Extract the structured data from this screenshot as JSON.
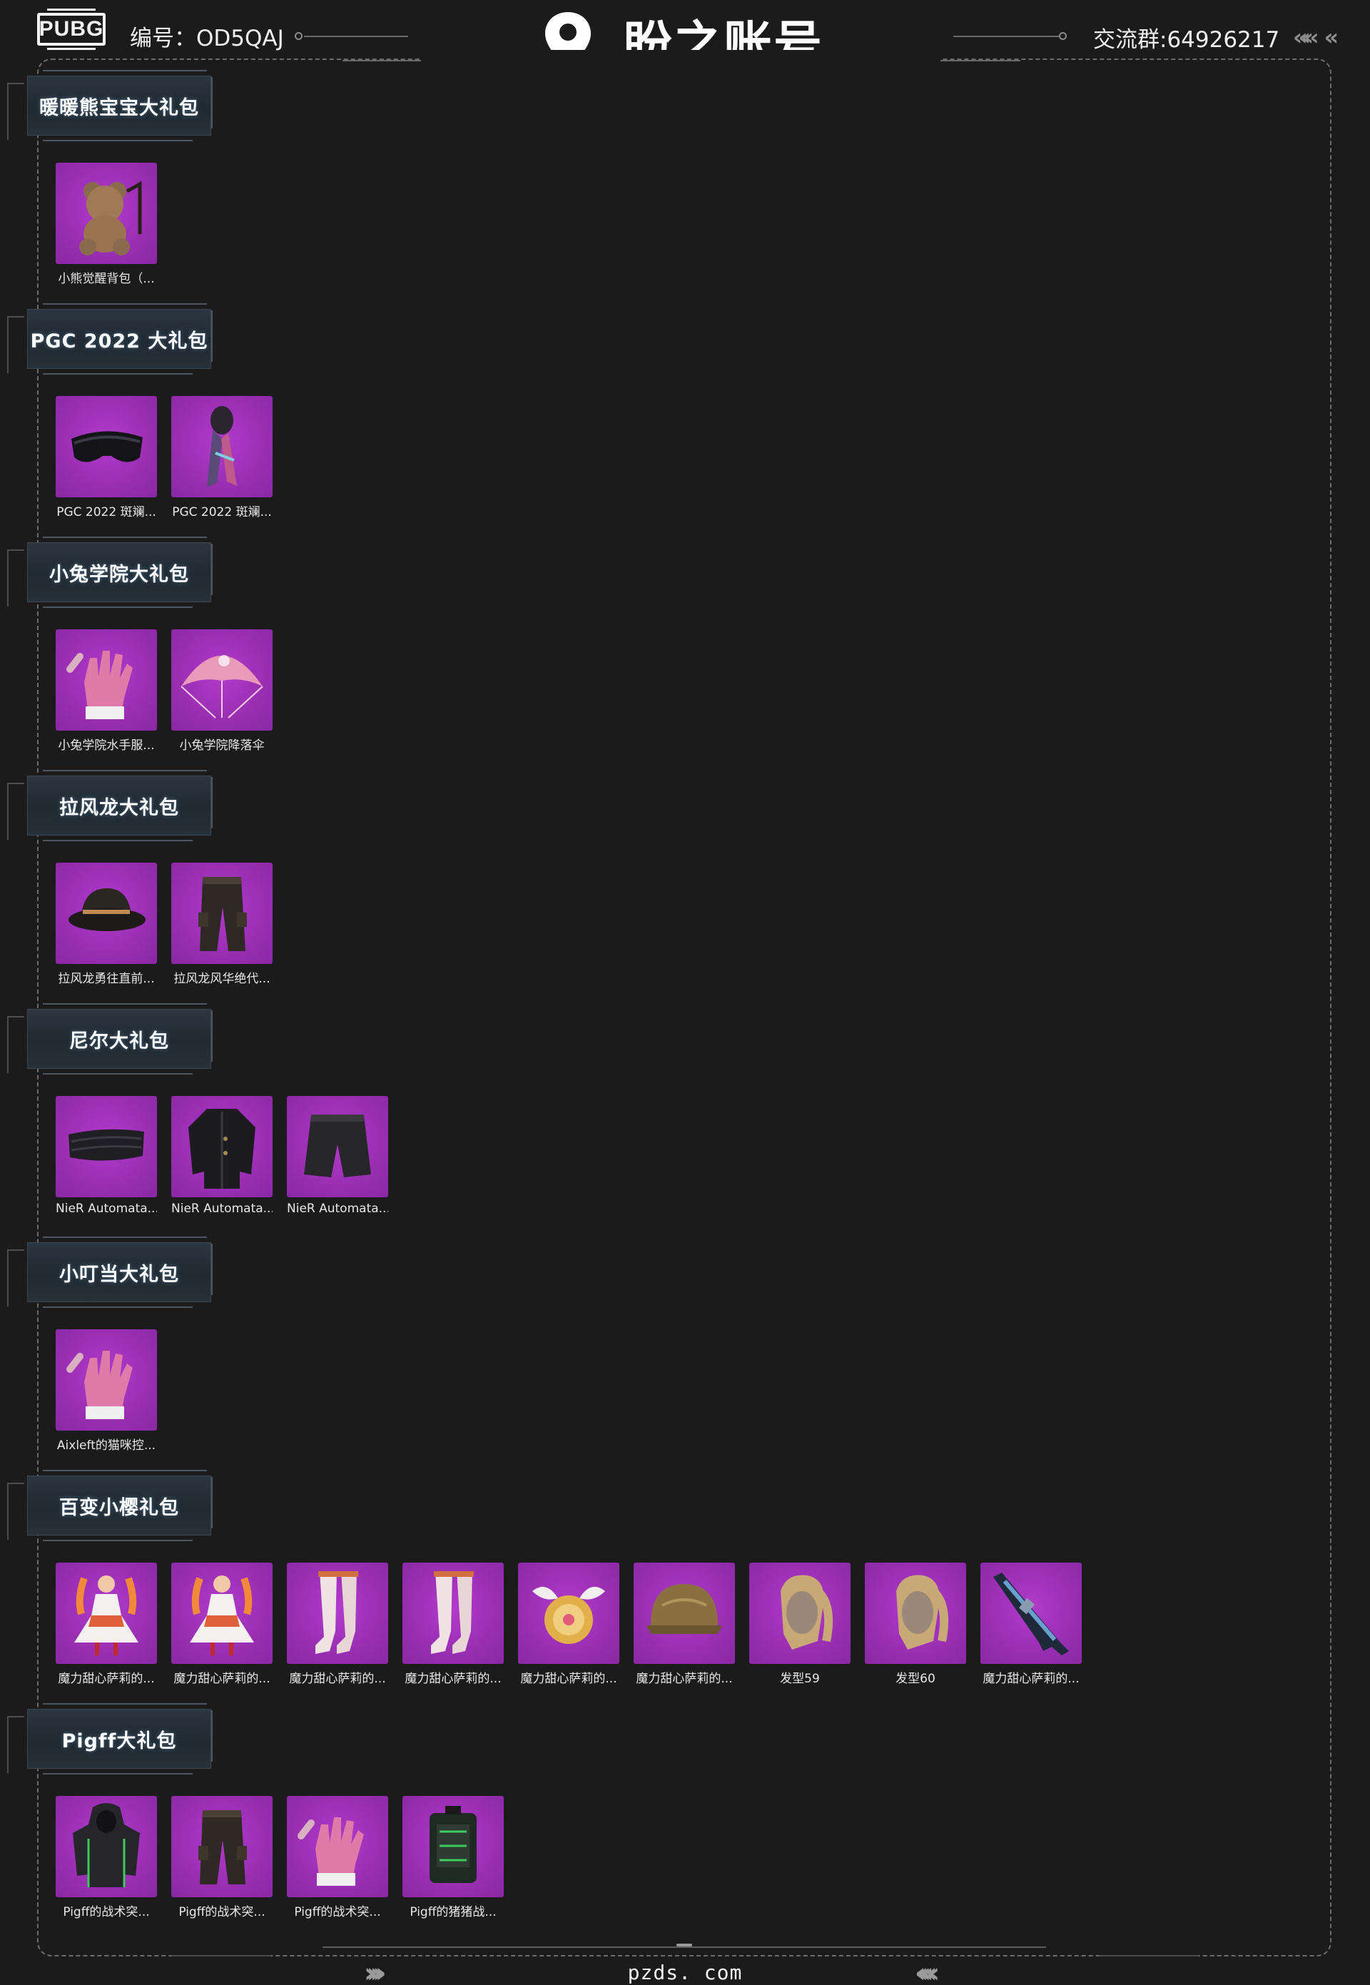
{
  "header": {
    "logo_text": "PUBG",
    "account_id": "编号：OD5QAJ",
    "brand_name": "盼之账号",
    "group_number": "交流群:64926217"
  },
  "colors": {
    "background": "#1b1b1c",
    "item_bg": "#a033bb",
    "text": "#ffffff"
  },
  "sections": [
    {
      "title": "暖暖熊宝宝大礼包",
      "items": [
        {
          "name": "小熊觉醒背包（...",
          "icon": "teddy-bear-backpack-icon"
        }
      ]
    },
    {
      "title": "PGC 2022 大礼包",
      "items": [
        {
          "name": "PGC 2022 斑斓...",
          "icon": "goggles-icon"
        },
        {
          "name": "PGC 2022 斑斓...",
          "icon": "scarf-mask-icon"
        }
      ]
    },
    {
      "title": "小兔学院大礼包",
      "items": [
        {
          "name": "小兔学院水手服...",
          "icon": "glove-icon"
        },
        {
          "name": "小兔学院降落伞",
          "icon": "parachute-icon"
        }
      ]
    },
    {
      "title": "拉风龙大礼包",
      "items": [
        {
          "name": "拉风龙勇往直前...",
          "icon": "bucket-hat-icon"
        },
        {
          "name": "拉风龙风华绝代...",
          "icon": "pants-icon"
        }
      ]
    },
    {
      "title": "尼尔大礼包",
      "items": [
        {
          "name": "NieR Automata...",
          "icon": "blindfold-icon"
        },
        {
          "name": "NieR Automata...",
          "icon": "coat-icon"
        },
        {
          "name": "NieR Automata...",
          "icon": "shorts-icon"
        }
      ]
    },
    {
      "title": "小叮当大礼包",
      "items": [
        {
          "name": "Aixleft的猫咪控...",
          "icon": "glove-icon"
        }
      ]
    },
    {
      "title": "百变小樱礼包",
      "items": [
        {
          "name": "魔力甜心萨莉的...",
          "icon": "dress-icon"
        },
        {
          "name": "魔力甜心萨莉的...",
          "icon": "dress-icon"
        },
        {
          "name": "魔力甜心萨莉的...",
          "icon": "stockings-icon"
        },
        {
          "name": "魔力甜心萨莉的...",
          "icon": "stockings-icon"
        },
        {
          "name": "魔力甜心萨莉的...",
          "icon": "winged-backpack-icon"
        },
        {
          "name": "魔力甜心萨莉的...",
          "icon": "helmet-icon"
        },
        {
          "name": "发型59",
          "icon": "hairstyle-icon"
        },
        {
          "name": "发型60",
          "icon": "hairstyle-icon"
        },
        {
          "name": "魔力甜心萨莉的...",
          "icon": "rifle-icon"
        }
      ]
    },
    {
      "title": "Pigff大礼包",
      "items": [
        {
          "name": "Pigff的战术突...",
          "icon": "hoodie-icon"
        },
        {
          "name": "Pigff的战术突...",
          "icon": "pants-icon"
        },
        {
          "name": "Pigff的战术突...",
          "icon": "glove-icon"
        },
        {
          "name": "Pigff的猪猪战...",
          "icon": "backpack-icon"
        }
      ]
    }
  ],
  "footer": {
    "site": "pzds. com"
  }
}
